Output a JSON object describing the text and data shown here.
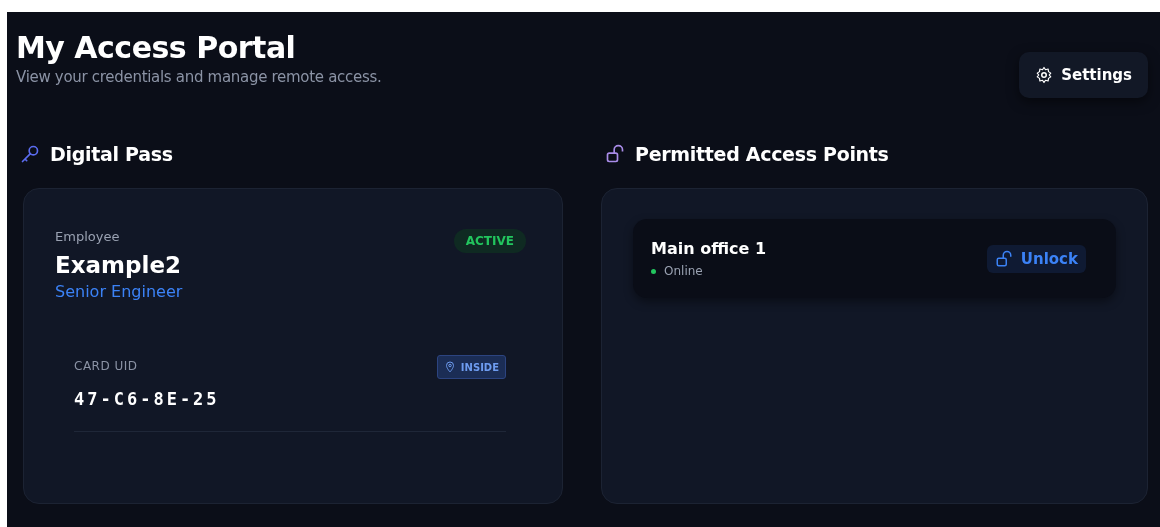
{
  "header": {
    "title": "My Access Portal",
    "subtitle": "View your credentials and manage remote access.",
    "settings_button": "Settings"
  },
  "digital_pass": {
    "heading": "Digital Pass",
    "role_label": "Employee",
    "name": "Example2",
    "job_title": "Senior Engineer",
    "status": {
      "text": "ACTIVE",
      "kind": "active"
    },
    "card_uid_label": "CARD UID",
    "card_uid": "47-C6-8E-25",
    "location": {
      "text": "INSIDE",
      "kind": "inside"
    }
  },
  "access_points": {
    "heading": "Permitted Access Points",
    "items": [
      {
        "name": "Main office 1",
        "status": "Online",
        "online": true,
        "action": "Unlock"
      }
    ]
  }
}
